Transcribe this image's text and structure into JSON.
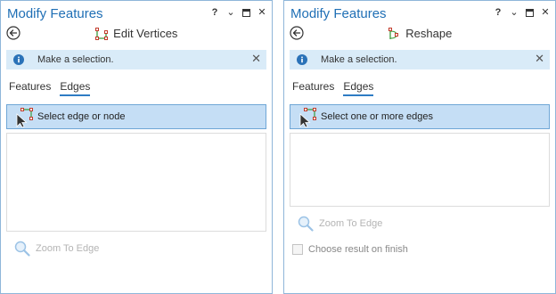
{
  "panes": [
    {
      "title": "Modify Features",
      "controls": {
        "help": "?",
        "menu": "⌄",
        "close": "✕"
      },
      "tool_name": "Edit Vertices",
      "info_message": "Make a selection.",
      "info_close": "✕",
      "tabs": [
        {
          "label": "Features"
        },
        {
          "label": "Edges"
        }
      ],
      "active_tab": "Edges",
      "selector_label": "Select edge or node",
      "zoom_label": "Zoom To Edge"
    },
    {
      "title": "Modify Features",
      "controls": {
        "help": "?",
        "menu": "⌄",
        "close": "✕"
      },
      "tool_name": "Reshape",
      "info_message": "Make a selection.",
      "info_close": "✕",
      "tabs": [
        {
          "label": "Features"
        },
        {
          "label": "Edges"
        }
      ],
      "active_tab": "Edges",
      "selector_label": "Select one or more edges",
      "zoom_label": "Zoom To Edge",
      "choose_result_label": "Choose result on finish",
      "choose_result_checked": false
    }
  ],
  "colors": {
    "title": "#1f6fb5",
    "info_bar": "#d9ebf8",
    "selector_bg": "#c5def5",
    "selector_border": "#6fa6d6",
    "active_tab_underline": "#2e7cc4",
    "disabled_text": "#b4b4b4"
  },
  "icons": {
    "back": "back-arrow-icon",
    "info": "info-icon",
    "edit_vertices": "edit-vertices-icon",
    "reshape": "reshape-icon",
    "select_edge": "select-edge-cursor-icon",
    "zoom": "magnifier-icon"
  }
}
